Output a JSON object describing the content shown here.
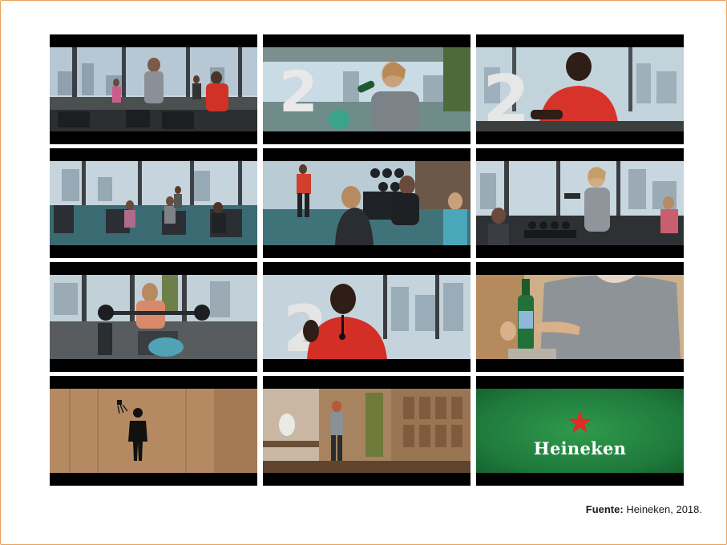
{
  "storyboard": {
    "stills": [
      {
        "scene": "gym-window-group"
      },
      {
        "scene": "woman-drinking-number-2"
      },
      {
        "scene": "trainer-red-shirt-number-2"
      },
      {
        "scene": "gym-machines-wide"
      },
      {
        "scene": "women-weights-rack"
      },
      {
        "scene": "woman-dumbbells-window"
      },
      {
        "scene": "man-bench-press"
      },
      {
        "scene": "trainer-red-shirt-closeup"
      },
      {
        "scene": "bottle-closeup"
      },
      {
        "scene": "shower-sign"
      },
      {
        "scene": "locker-room-woman"
      },
      {
        "scene": "brand-endcard"
      }
    ],
    "endcard_brand": "Heineken",
    "endcard_color": "#1f7a3c"
  },
  "caption": {
    "label": "Fuente:",
    "text": " Heineken, 2018."
  }
}
